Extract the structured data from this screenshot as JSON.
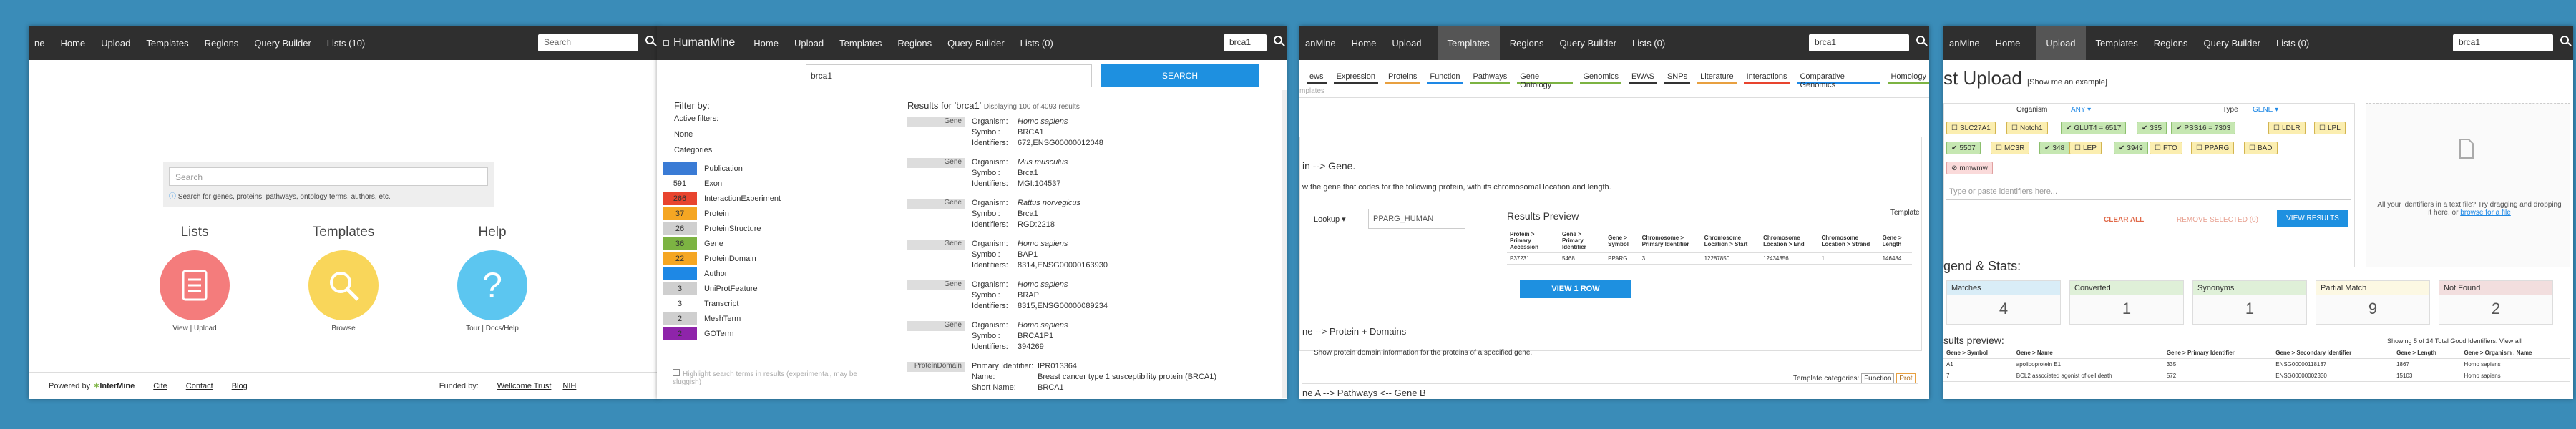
{
  "panel1": {
    "nav": [
      "Home",
      "Upload",
      "Templates",
      "Regions",
      "Query Builder",
      "Lists (10)"
    ],
    "logo_frag": "ne",
    "search_placeholder": "Search",
    "home_search_placeholder": "Search",
    "home_hint": "Search for genes, proteins, pathways, ontology terms, authors, etc.",
    "sections": [
      {
        "title": "Lists",
        "sub": "View | Upload"
      },
      {
        "title": "Templates",
        "sub": "Browse"
      },
      {
        "title": "Help",
        "sub": "Tour | Docs/Help"
      }
    ],
    "footer": {
      "powered": "Powered by",
      "brand": "InterMine",
      "links": [
        "Cite",
        "Contact",
        "Blog"
      ],
      "funded": "Funded by:",
      "funders": [
        "Wellcome Trust",
        "NIH"
      ]
    }
  },
  "panel2": {
    "logo": "HumanMine",
    "nav": [
      "Home",
      "Upload",
      "Templates",
      "Regions",
      "Query Builder",
      "Lists (0)"
    ],
    "nav_search": "brca1",
    "query": "brca1",
    "search_btn": "SEARCH",
    "filter_title": "Filter by:",
    "active_filters_label": "Active filters:",
    "active_filters_value": "None",
    "categories_label": "Categories",
    "categories": [
      {
        "count": "",
        "name": "Publication",
        "color": "#3a7bd5"
      },
      {
        "count": "591",
        "name": "Exon",
        "color": "#ffffff"
      },
      {
        "count": "266",
        "name": "InteractionExperiment",
        "color": "#e8442e"
      },
      {
        "count": "37",
        "name": "Protein",
        "color": "#f5a623"
      },
      {
        "count": "26",
        "name": "ProteinStructure",
        "color": "#cfcfcf"
      },
      {
        "count": "36",
        "name": "Gene",
        "color": "#7cb342"
      },
      {
        "count": "22",
        "name": "ProteinDomain",
        "color": "#f5a623"
      },
      {
        "count": "",
        "name": "Author",
        "color": "#1e88e5"
      },
      {
        "count": "3",
        "name": "UniProtFeature",
        "color": "#cfcfcf"
      },
      {
        "count": "3",
        "name": "Transcript",
        "color": "#ffffff"
      },
      {
        "count": "2",
        "name": "MeshTerm",
        "color": "#cfcfcf"
      },
      {
        "count": "2",
        "name": "GOTerm",
        "color": "#8e24aa"
      }
    ],
    "highlight_text": "Highlight search terms in results (experimental, may be sluggish)",
    "results_title": "Results for 'brca1'",
    "results_sub": "Displaying 100 of 4093 results",
    "results": [
      {
        "type": "Gene",
        "rows": [
          [
            "Organism:",
            "Homo sapiens"
          ],
          [
            "Symbol:",
            "BRCA1"
          ],
          [
            "Identifiers:",
            "672,ENSG00000012048"
          ]
        ]
      },
      {
        "type": "Gene",
        "rows": [
          [
            "Organism:",
            "Mus musculus"
          ],
          [
            "Symbol:",
            "Brca1"
          ],
          [
            "Identifiers:",
            "MGI:104537"
          ]
        ]
      },
      {
        "type": "Gene",
        "rows": [
          [
            "Organism:",
            "Rattus norvegicus"
          ],
          [
            "Symbol:",
            "Brca1"
          ],
          [
            "Identifiers:",
            "RGD:2218"
          ]
        ]
      },
      {
        "type": "Gene",
        "rows": [
          [
            "Organism:",
            "Homo sapiens"
          ],
          [
            "Symbol:",
            "BAP1"
          ],
          [
            "Identifiers:",
            "8314,ENSG00000163930"
          ]
        ]
      },
      {
        "type": "Gene",
        "rows": [
          [
            "Organism:",
            "Homo sapiens"
          ],
          [
            "Symbol:",
            "BRAP"
          ],
          [
            "Identifiers:",
            "8315,ENSG00000089234"
          ]
        ]
      },
      {
        "type": "Gene",
        "rows": [
          [
            "Organism:",
            "Homo sapiens"
          ],
          [
            "Symbol:",
            "BRCA1P1"
          ],
          [
            "Identifiers:",
            "394269"
          ]
        ]
      },
      {
        "type": "ProteinDomain",
        "rows": [
          [
            "Primary Identifier:",
            "IPR013364"
          ],
          [
            "Name:",
            "Breast cancer type 1 susceptibility protein (BRCA1)"
          ],
          [
            "Short Name:",
            "BRCA1"
          ]
        ]
      }
    ]
  },
  "panel3": {
    "logo_frag": "anMine",
    "nav": [
      "Home",
      "Upload",
      "Templates",
      "Regions",
      "Query Builder",
      "Lists (0)"
    ],
    "nav_search": "brca1",
    "tabs": [
      "ews",
      "Expression",
      "Proteins",
      "Function",
      "Pathways",
      "Gene Ontology",
      "Genomics",
      "EWAS",
      "SNPs",
      "Literature",
      "Interactions",
      "Comparative Genomics",
      "Homology"
    ],
    "templates_label": "mplates",
    "t1_title": "in --> Gene.",
    "t1_desc": "w the gene that codes for the following protein, with its chromosomal location and length.",
    "lookup_label": "Lookup",
    "lookup_value": "PPARG_HUMAN",
    "preview_title": "Results Preview",
    "template_label": "Template",
    "preview_cols": [
      "Protein > Primary Accession",
      "Gene > Primary Identifier",
      "Gene > Symbol",
      "Chromosome > Primary Identifier",
      "Chromosome Location > Start",
      "Chromosome Location > End",
      "Chromosome Location > Strand",
      "Gene > Length"
    ],
    "preview_row": [
      "P37231",
      "5468",
      "PPARG",
      "3",
      "12287850",
      "12434356",
      "1",
      "146484"
    ],
    "view_btn": "VIEW 1 ROW",
    "t2_title": "ne --> Protein + Domains",
    "t2_desc": "Show protein domain information for the proteins of a specified gene.",
    "cats_label": "Template categories:",
    "cats": [
      "Function",
      "Prot"
    ],
    "t3_title": "ne A --> Pathways <-- Gene B"
  },
  "panel4": {
    "logo_frag": "anMine",
    "nav": [
      "Home",
      "Upload",
      "Templates",
      "Regions",
      "Query Builder",
      "Lists (0)"
    ],
    "nav_search": "brca1",
    "title": "st Upload",
    "example_link": "[Show me an example]",
    "organism_label": "Organism",
    "organism_value": "ANY",
    "type_label": "Type",
    "type_value": "GENE",
    "chips": [
      {
        "t": "SLC27A1",
        "c": "y"
      },
      {
        "t": "Notch1",
        "c": "y"
      },
      {
        "t": "GLUT4 = 6517",
        "c": "g"
      },
      {
        "t": "335",
        "c": "g"
      },
      {
        "t": "PSS16 = 7303",
        "c": "g"
      },
      {
        "t": "LDLR",
        "c": "y"
      },
      {
        "t": "LPL",
        "c": "y"
      },
      {
        "t": "5507",
        "c": "g"
      },
      {
        "t": "MC3R",
        "c": "y"
      },
      {
        "t": "348",
        "c": "g"
      },
      {
        "t": "LEP",
        "c": "y"
      },
      {
        "t": "3949",
        "c": "g"
      },
      {
        "t": "FTO",
        "c": "y"
      },
      {
        "t": "PPARG",
        "c": "y"
      },
      {
        "t": "BAD",
        "c": "y"
      },
      {
        "t": "mmwmw",
        "c": "r"
      }
    ],
    "paste_placeholder": "Type or paste identifiers here...",
    "clear_btn": "CLEAR ALL",
    "remove_btn": "REMOVE SELECTED (0)",
    "view_btn": "VIEW RESULTS",
    "drop_text": "All your identifiers in a text file? Try dragging and dropping it here, or",
    "drop_link": "browse for a file",
    "legend_title": "gend & Stats:",
    "stats": [
      {
        "label": "Matches",
        "value": "4",
        "color": "#d9edf7"
      },
      {
        "label": "Converted",
        "value": "1",
        "color": "#dff0d8"
      },
      {
        "label": "Synonyms",
        "value": "1",
        "color": "#dff0d8"
      },
      {
        "label": "Partial Match",
        "value": "9",
        "color": "#fcf8e3"
      },
      {
        "label": "Not Found",
        "value": "2",
        "color": "#f2dede"
      }
    ],
    "preview_title": "sults preview:",
    "preview_note": "Showing 5 of 14 Total Good Identifiers. View all",
    "cols": [
      "Gene > Symbol",
      "Gene > Name",
      "Gene > Primary Identifier",
      "Gene > Secondary Identifier",
      "Gene > Length",
      "Gene > Organism . Name"
    ],
    "rows": [
      [
        "A1",
        "apolipoprotein E1",
        "335",
        "ENSG00000118137",
        "1867",
        "Homo sapiens"
      ],
      [
        "7",
        "BCL2 associated agonist of cell death",
        "572",
        "ENSG00000002330",
        "15103",
        "Homo sapiens"
      ]
    ]
  }
}
